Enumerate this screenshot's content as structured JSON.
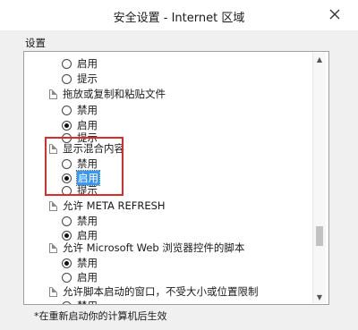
{
  "window": {
    "title": "安全设置 - Internet 区域"
  },
  "section_label": "设置",
  "items": [
    {
      "type": "radio",
      "label": "启用",
      "checked": false
    },
    {
      "type": "radio",
      "label": "提示",
      "checked": false
    },
    {
      "type": "header",
      "label": "拖放或复制和粘贴文件"
    },
    {
      "type": "radio",
      "label": "禁用",
      "checked": false
    },
    {
      "type": "radio",
      "label": "启用",
      "checked": true
    },
    {
      "type": "radio",
      "label": "提示",
      "checked": false
    },
    {
      "type": "header",
      "label": "显示混合内容"
    },
    {
      "type": "radio",
      "label": "禁用",
      "checked": false
    },
    {
      "type": "radio",
      "label": "启用",
      "checked": true,
      "selected": true
    },
    {
      "type": "radio",
      "label": "提示",
      "checked": false
    },
    {
      "type": "header",
      "label": "允许 META REFRESH"
    },
    {
      "type": "radio",
      "label": "禁用",
      "checked": false
    },
    {
      "type": "radio",
      "label": "启用",
      "checked": true
    },
    {
      "type": "header",
      "label": "允许 Microsoft Web 浏览器控件的脚本"
    },
    {
      "type": "radio",
      "label": "禁用",
      "checked": true
    },
    {
      "type": "radio",
      "label": "启用",
      "checked": false
    },
    {
      "type": "header",
      "label": "允许脚本启动的窗口，不受大小或位置限制"
    },
    {
      "type": "radio",
      "label": "禁用",
      "checked": true
    }
  ],
  "footnote": "*在重新启动你的计算机后生效",
  "accent": "#3399ff",
  "annotation_color": "#d62d2d"
}
